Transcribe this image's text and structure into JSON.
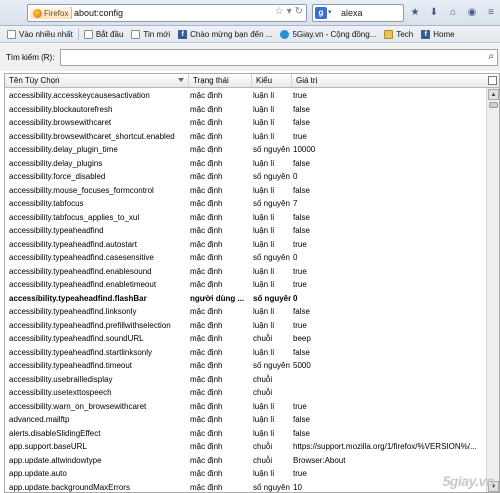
{
  "navbar": {
    "identity_label": "Firefox",
    "url": "about:config",
    "search_engine_icon": "google-icon",
    "search_text": "alexa"
  },
  "bookmarks": [
    {
      "label": "Vào nhiều nhất",
      "icon": "page-icon"
    },
    {
      "label": "Bắt đầu",
      "icon": "page-icon"
    },
    {
      "label": "Tin mới",
      "icon": "page-icon"
    },
    {
      "label": "Chào mừng bạn đến ...",
      "icon": "facebook-icon"
    },
    {
      "label": "5Giay.vn - Cộng đồng...",
      "icon": "fivegiay-icon"
    },
    {
      "label": "Tech",
      "icon": "folder-icon"
    },
    {
      "label": "Home",
      "icon": "facebook-icon"
    }
  ],
  "filter": {
    "label": "Tìm kiếm (R):",
    "value": ""
  },
  "table": {
    "headers": [
      "Tên Tùy Chọn",
      "Trạng thái",
      "Kiểu",
      "Giá trị"
    ],
    "rows": [
      {
        "name": "accessibility.accesskeycausesactivation",
        "status": "mặc định",
        "type": "luận lí",
        "value": "true"
      },
      {
        "name": "accessibility.blockautorefresh",
        "status": "mặc định",
        "type": "luận lí",
        "value": "false"
      },
      {
        "name": "accessibility.browsewithcaret",
        "status": "mặc định",
        "type": "luận lí",
        "value": "false"
      },
      {
        "name": "accessibility.browsewithcaret_shortcut.enabled",
        "status": "mặc định",
        "type": "luận lí",
        "value": "true"
      },
      {
        "name": "accessibility.delay_plugin_time",
        "status": "mặc định",
        "type": "số nguyên",
        "value": "10000"
      },
      {
        "name": "accessibility.delay_plugins",
        "status": "mặc định",
        "type": "luận lí",
        "value": "false"
      },
      {
        "name": "accessibility.force_disabled",
        "status": "mặc định",
        "type": "số nguyên",
        "value": "0"
      },
      {
        "name": "accessibility.mouse_focuses_formcontrol",
        "status": "mặc định",
        "type": "luận lí",
        "value": "false"
      },
      {
        "name": "accessibility.tabfocus",
        "status": "mặc định",
        "type": "số nguyên",
        "value": "7"
      },
      {
        "name": "accessibility.tabfocus_applies_to_xul",
        "status": "mặc định",
        "type": "luận lí",
        "value": "false"
      },
      {
        "name": "accessibility.typeaheadfind",
        "status": "mặc định",
        "type": "luận lí",
        "value": "false"
      },
      {
        "name": "accessibility.typeaheadfind.autostart",
        "status": "mặc định",
        "type": "luận lí",
        "value": "true"
      },
      {
        "name": "accessibility.typeaheadfind.casesensitive",
        "status": "mặc định",
        "type": "số nguyên",
        "value": "0"
      },
      {
        "name": "accessibility.typeaheadfind.enablesound",
        "status": "mặc định",
        "type": "luận lí",
        "value": "true"
      },
      {
        "name": "accessibility.typeaheadfind.enabletimeout",
        "status": "mặc định",
        "type": "luận lí",
        "value": "true"
      },
      {
        "name": "accessibility.typeaheadfind.flashBar",
        "status": "người dùng ...",
        "type": "số nguyên",
        "value": "0",
        "bold": true
      },
      {
        "name": "accessibility.typeaheadfind.linksonly",
        "status": "mặc định",
        "type": "luận lí",
        "value": "false"
      },
      {
        "name": "accessibility.typeaheadfind.prefillwithselection",
        "status": "mặc định",
        "type": "luận lí",
        "value": "true"
      },
      {
        "name": "accessibility.typeaheadfind.soundURL",
        "status": "mặc định",
        "type": "chuỗi",
        "value": "beep"
      },
      {
        "name": "accessibility.typeaheadfind.startlinksonly",
        "status": "mặc định",
        "type": "luận lí",
        "value": "false"
      },
      {
        "name": "accessibility.typeaheadfind.timeout",
        "status": "mặc định",
        "type": "số nguyên",
        "value": "5000"
      },
      {
        "name": "accessibility.usebrailledisplay",
        "status": "mặc định",
        "type": "chuỗi",
        "value": ""
      },
      {
        "name": "accessibility.usetexttospeech",
        "status": "mặc định",
        "type": "chuỗi",
        "value": ""
      },
      {
        "name": "accessibility.warn_on_browsewithcaret",
        "status": "mặc định",
        "type": "luận lí",
        "value": "true"
      },
      {
        "name": "advanced.mailftp",
        "status": "mặc định",
        "type": "luận lí",
        "value": "false"
      },
      {
        "name": "alerts.disableSlidingEffect",
        "status": "mặc định",
        "type": "luận lí",
        "value": "false"
      },
      {
        "name": "app.support.baseURL",
        "status": "mặc định",
        "type": "chuỗi",
        "value": "https://support.mozilla.org/1/firefox/%VERSION%/..."
      },
      {
        "name": "app.update.altwindowtype",
        "status": "mặc định",
        "type": "chuỗi",
        "value": "Browser:About"
      },
      {
        "name": "app.update.auto",
        "status": "mặc định",
        "type": "luận lí",
        "value": "true"
      },
      {
        "name": "app.update.backgroundMaxErrors",
        "status": "mặc định",
        "type": "số nguyên",
        "value": "10"
      }
    ]
  },
  "watermark": "5giay.vn"
}
